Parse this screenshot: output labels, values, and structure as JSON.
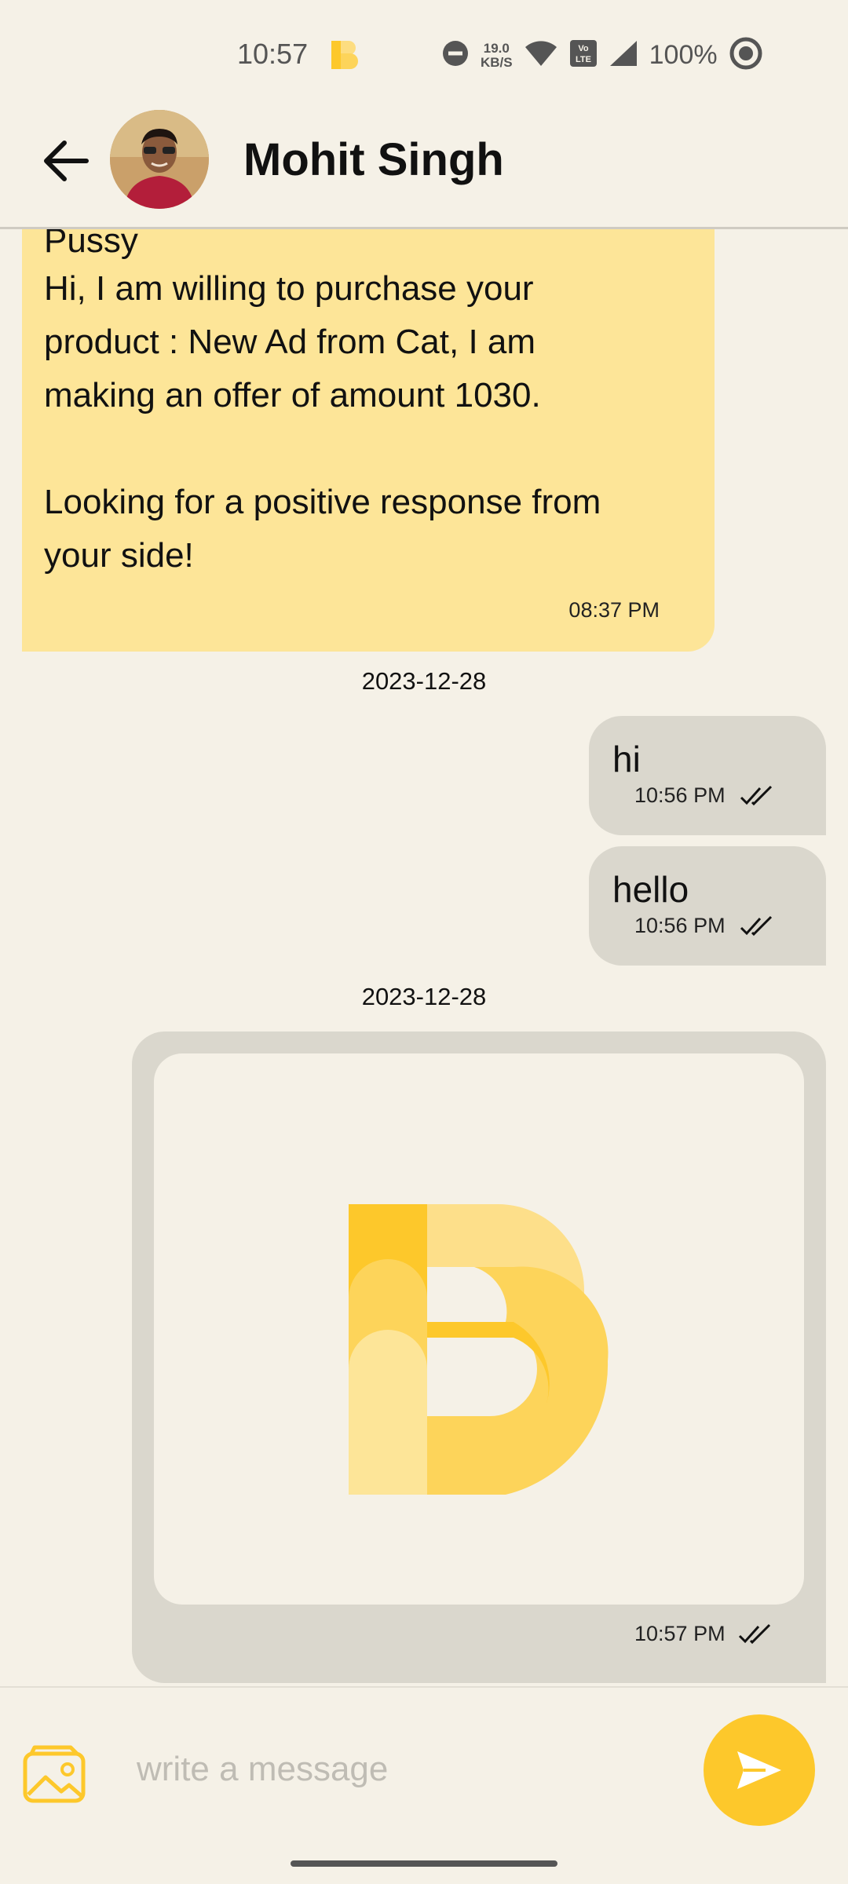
{
  "status_bar": {
    "time": "10:57",
    "speed_value": "19.0",
    "speed_unit": "KB/S",
    "network": "LTE",
    "battery": "100%"
  },
  "header": {
    "contact_name": "Mohit Singh"
  },
  "messages": {
    "incoming": {
      "sender": "Pussy",
      "text": "Hi, I am willing to purchase your\nproduct : New Ad from Cat, I am\nmaking an offer of amount 1030.\n\nLooking for a positive response from\nyour side!",
      "time": "08:37 PM"
    },
    "date_1": "2023-12-28",
    "out_1": {
      "text": "hi",
      "time": "10:56 PM"
    },
    "out_2": {
      "text": "hello",
      "time": "10:56 PM"
    },
    "date_2": "2023-12-28",
    "image_msg": {
      "time": "10:57 PM"
    }
  },
  "composer": {
    "placeholder": "write a message"
  },
  "colors": {
    "accent": "#fdc82b",
    "incoming_bubble": "#fde598",
    "outgoing_bubble": "#dad7cd",
    "background": "#f5f1e7"
  },
  "icons": {
    "back": "arrow-left-icon",
    "gallery": "image-gallery-icon",
    "send": "send-icon",
    "read_receipt": "double-check-icon"
  }
}
